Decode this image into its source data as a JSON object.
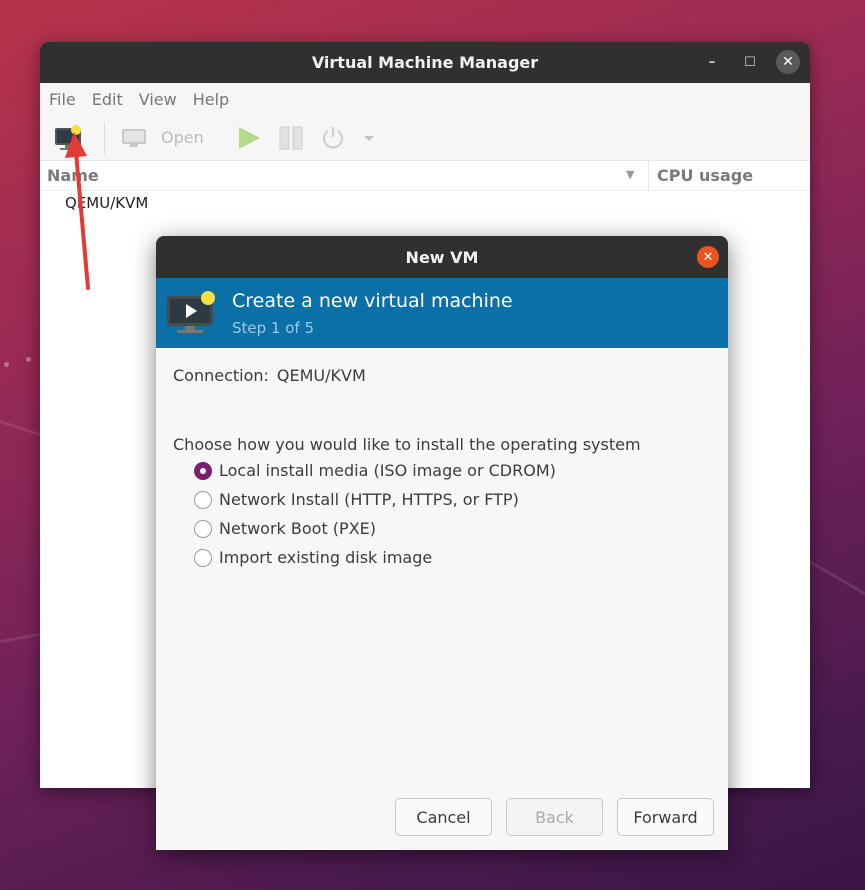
{
  "main_window": {
    "title": "Virtual Machine Manager",
    "menu": [
      "File",
      "Edit",
      "View",
      "Help"
    ],
    "toolbar": {
      "open_label": "Open"
    },
    "columns": {
      "name": "Name",
      "cpu": "CPU usage"
    },
    "connection_row": "QEMU/KVM"
  },
  "dialog": {
    "title": "New VM",
    "banner_title": "Create a new virtual machine",
    "banner_step": "Step 1 of 5",
    "connection_label": "Connection:",
    "connection_value": "QEMU/KVM",
    "prompt": "Choose how you would like to install the operating system",
    "options": [
      {
        "label": "Local install media (ISO image or CDROM)",
        "selected": true
      },
      {
        "label": "Network Install (HTTP, HTTPS, or FTP)",
        "selected": false
      },
      {
        "label": "Network Boot (PXE)",
        "selected": false
      },
      {
        "label": "Import existing disk image",
        "selected": false
      }
    ],
    "buttons": {
      "cancel": "Cancel",
      "back": "Back",
      "forward": "Forward"
    }
  },
  "icons": [
    "new-vm-icon",
    "monitor-icon",
    "play-icon",
    "pause-icon",
    "power-icon",
    "dropdown-arrow-icon",
    "minimize-icon",
    "maximize-icon",
    "close-icon",
    "vm-monitor-icon"
  ],
  "colors": {
    "accent": "#77216f",
    "banner": "#0b6fa8",
    "close": "#e95420",
    "annotation_arrow": "#e53935"
  }
}
